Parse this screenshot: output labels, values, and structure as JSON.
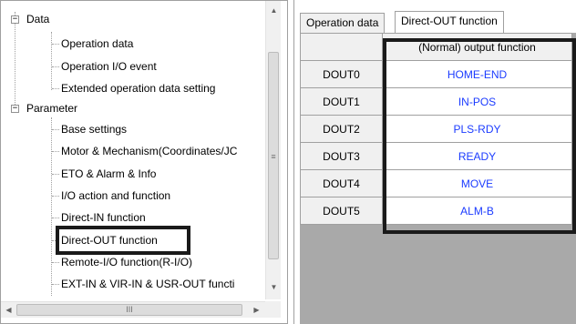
{
  "tree": {
    "nodes": [
      {
        "label": "Data",
        "toggle": "−"
      },
      {
        "label": "Operation data"
      },
      {
        "label": "Operation I/O event"
      },
      {
        "label": "Extended operation data setting"
      },
      {
        "label": "Parameter",
        "toggle": "−"
      },
      {
        "label": "Base settings"
      },
      {
        "label": "Motor & Mechanism(Coordinates/JC"
      },
      {
        "label": "ETO & Alarm & Info"
      },
      {
        "label": "I/O action and function"
      },
      {
        "label": "Direct-IN function"
      },
      {
        "label": "Direct-OUT function"
      },
      {
        "label": "Remote-I/O function(R-I/O)"
      },
      {
        "label": "EXT-IN & VIR-IN & USR-OUT functi"
      }
    ],
    "selected_item": "Direct-OUT function"
  },
  "scrollbars": {
    "up_arrow": "▲",
    "down_arrow": "▼",
    "left_arrow": "◀",
    "right_arrow": "▶",
    "v_grip": "≡",
    "h_grip": "III"
  },
  "tabs": [
    {
      "label": "Operation data",
      "active": false
    },
    {
      "label": "Direct-OUT function",
      "active": true
    }
  ],
  "grid": {
    "column_header": "(Normal) output function",
    "rows": [
      {
        "name": "DOUT0",
        "value": "HOME-END"
      },
      {
        "name": "DOUT1",
        "value": "IN-POS"
      },
      {
        "name": "DOUT2",
        "value": "PLS-RDY"
      },
      {
        "name": "DOUT3",
        "value": "READY"
      },
      {
        "name": "DOUT4",
        "value": "MOVE"
      },
      {
        "name": "DOUT5",
        "value": "ALM-B"
      }
    ]
  },
  "colors": {
    "value_text": "#1c3cff",
    "highlight_border": "#1a1a1a",
    "grid_background": "#a9a9a9"
  }
}
